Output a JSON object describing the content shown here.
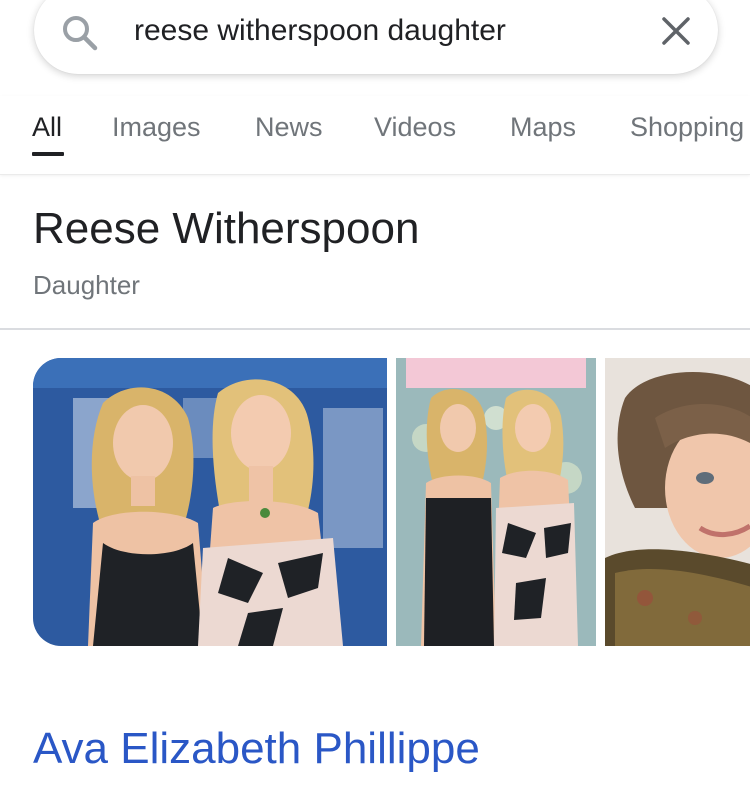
{
  "search": {
    "query": "reese witherspoon daughter",
    "icon": "search-icon",
    "clear_icon": "close-icon"
  },
  "tabs": [
    {
      "label": "All",
      "active": true
    },
    {
      "label": "Images",
      "active": false
    },
    {
      "label": "News",
      "active": false
    },
    {
      "label": "Videos",
      "active": false
    },
    {
      "label": "Maps",
      "active": false
    },
    {
      "label": "Shopping",
      "active": false
    }
  ],
  "knowledge": {
    "title": "Reese Witherspoon",
    "subtitle": "Daughter",
    "answer": "Ava Elizabeth Phillippe"
  },
  "colors": {
    "link": "#2a57c6",
    "muted": "#70757a",
    "text": "#202124"
  }
}
